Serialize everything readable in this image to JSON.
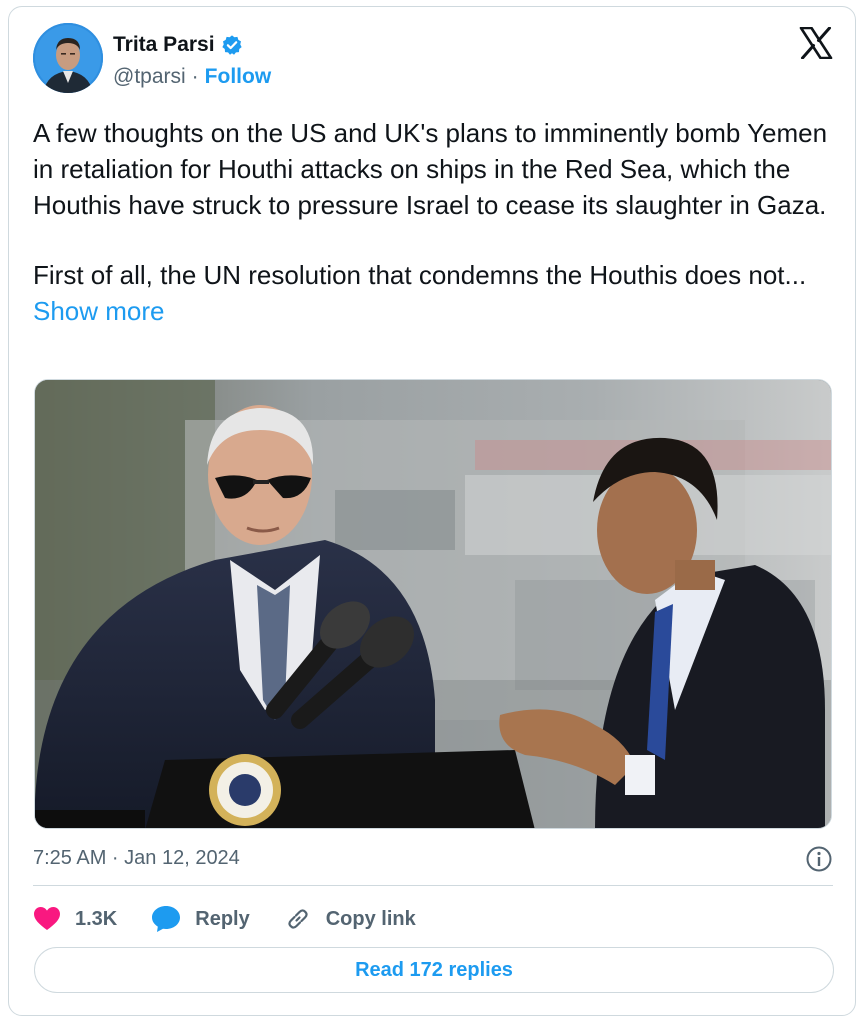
{
  "author": {
    "name": "Trita Parsi",
    "handle": "@tparsi",
    "separator": "·",
    "follow_label": "Follow"
  },
  "tweet": {
    "paragraph1": "A few thoughts on the US and UK's plans to imminently bomb Yemen in retaliation for Houthi attacks on ships in the Red Sea, which the Houthis have struck to pressure Israel to cease its slaughter in Gaza.",
    "paragraph2": "First of all, the UN resolution that condemns the Houthis does not...",
    "show_more": "Show more"
  },
  "timestamp": "7:25 AM · Jan 12, 2024",
  "actions": {
    "likes": "1.3K",
    "reply": "Reply",
    "copy_link": "Copy link"
  },
  "read_replies": "Read 172 replies",
  "icons": {
    "verified": "verified-badge-icon",
    "platform": "x-logo-icon",
    "info": "info-icon",
    "like": "heart-icon",
    "reply": "speech-bubble-icon",
    "copy": "link-icon"
  },
  "colors": {
    "accent": "#1d9bf0",
    "like": "#f91880",
    "secondary_text": "#536471",
    "border": "#cfd9de"
  }
}
